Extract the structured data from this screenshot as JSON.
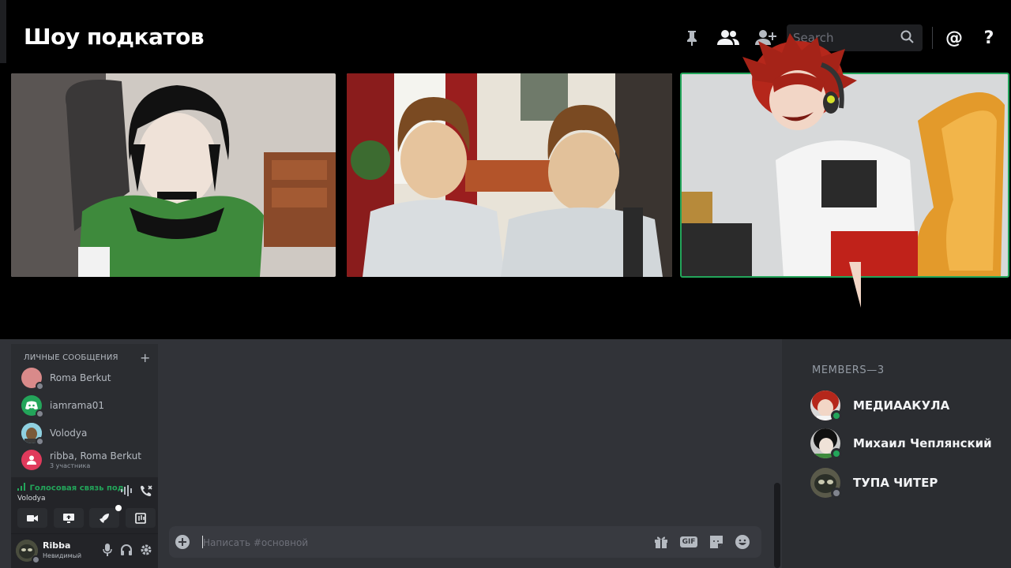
{
  "header": {
    "title": "Шоу подкатов",
    "search_placeholder": "Search",
    "icons": [
      "pin-icon",
      "members-icon",
      "add-friend-icon",
      "search-icon",
      "mention-icon",
      "help-icon"
    ],
    "help_glyph": "?",
    "mention_glyph": "@"
  },
  "video_tiles": [
    {
      "participant": "Михаил Чеплянский",
      "active": false
    },
    {
      "participant": "ТУПА ЧИТЕР",
      "active": false
    },
    {
      "participant": "МЕДИААКУЛА",
      "active": true
    }
  ],
  "dm": {
    "header": "ЛИЧНЫЕ СООБЩЕНИЯ",
    "plus": "+",
    "items": [
      {
        "name": "Roma Berkut",
        "sub": ""
      },
      {
        "name": "iamrama01",
        "sub": ""
      },
      {
        "name": "Volodya",
        "sub": ""
      },
      {
        "name": "ribba, Roma Berkut",
        "sub": "3 участника"
      }
    ]
  },
  "voice": {
    "status": "Голосовая связь под",
    "channel": "Volodya"
  },
  "user": {
    "name": "Ribba",
    "status": "Невидимый"
  },
  "composer": {
    "placeholder": "Написать #основной",
    "gif_label": "GIF"
  },
  "members": {
    "title": "MEMBERS—3",
    "items": [
      {
        "name": "МЕДИААКУЛА",
        "status": "online"
      },
      {
        "name": "Михаил Чеплянский",
        "status": "online"
      },
      {
        "name": "ТУПА ЧИТЕР",
        "status": "offline"
      }
    ]
  },
  "colors": {
    "online": "#23a55a",
    "offline": "#80848e",
    "accent_green": "#23a55a"
  }
}
